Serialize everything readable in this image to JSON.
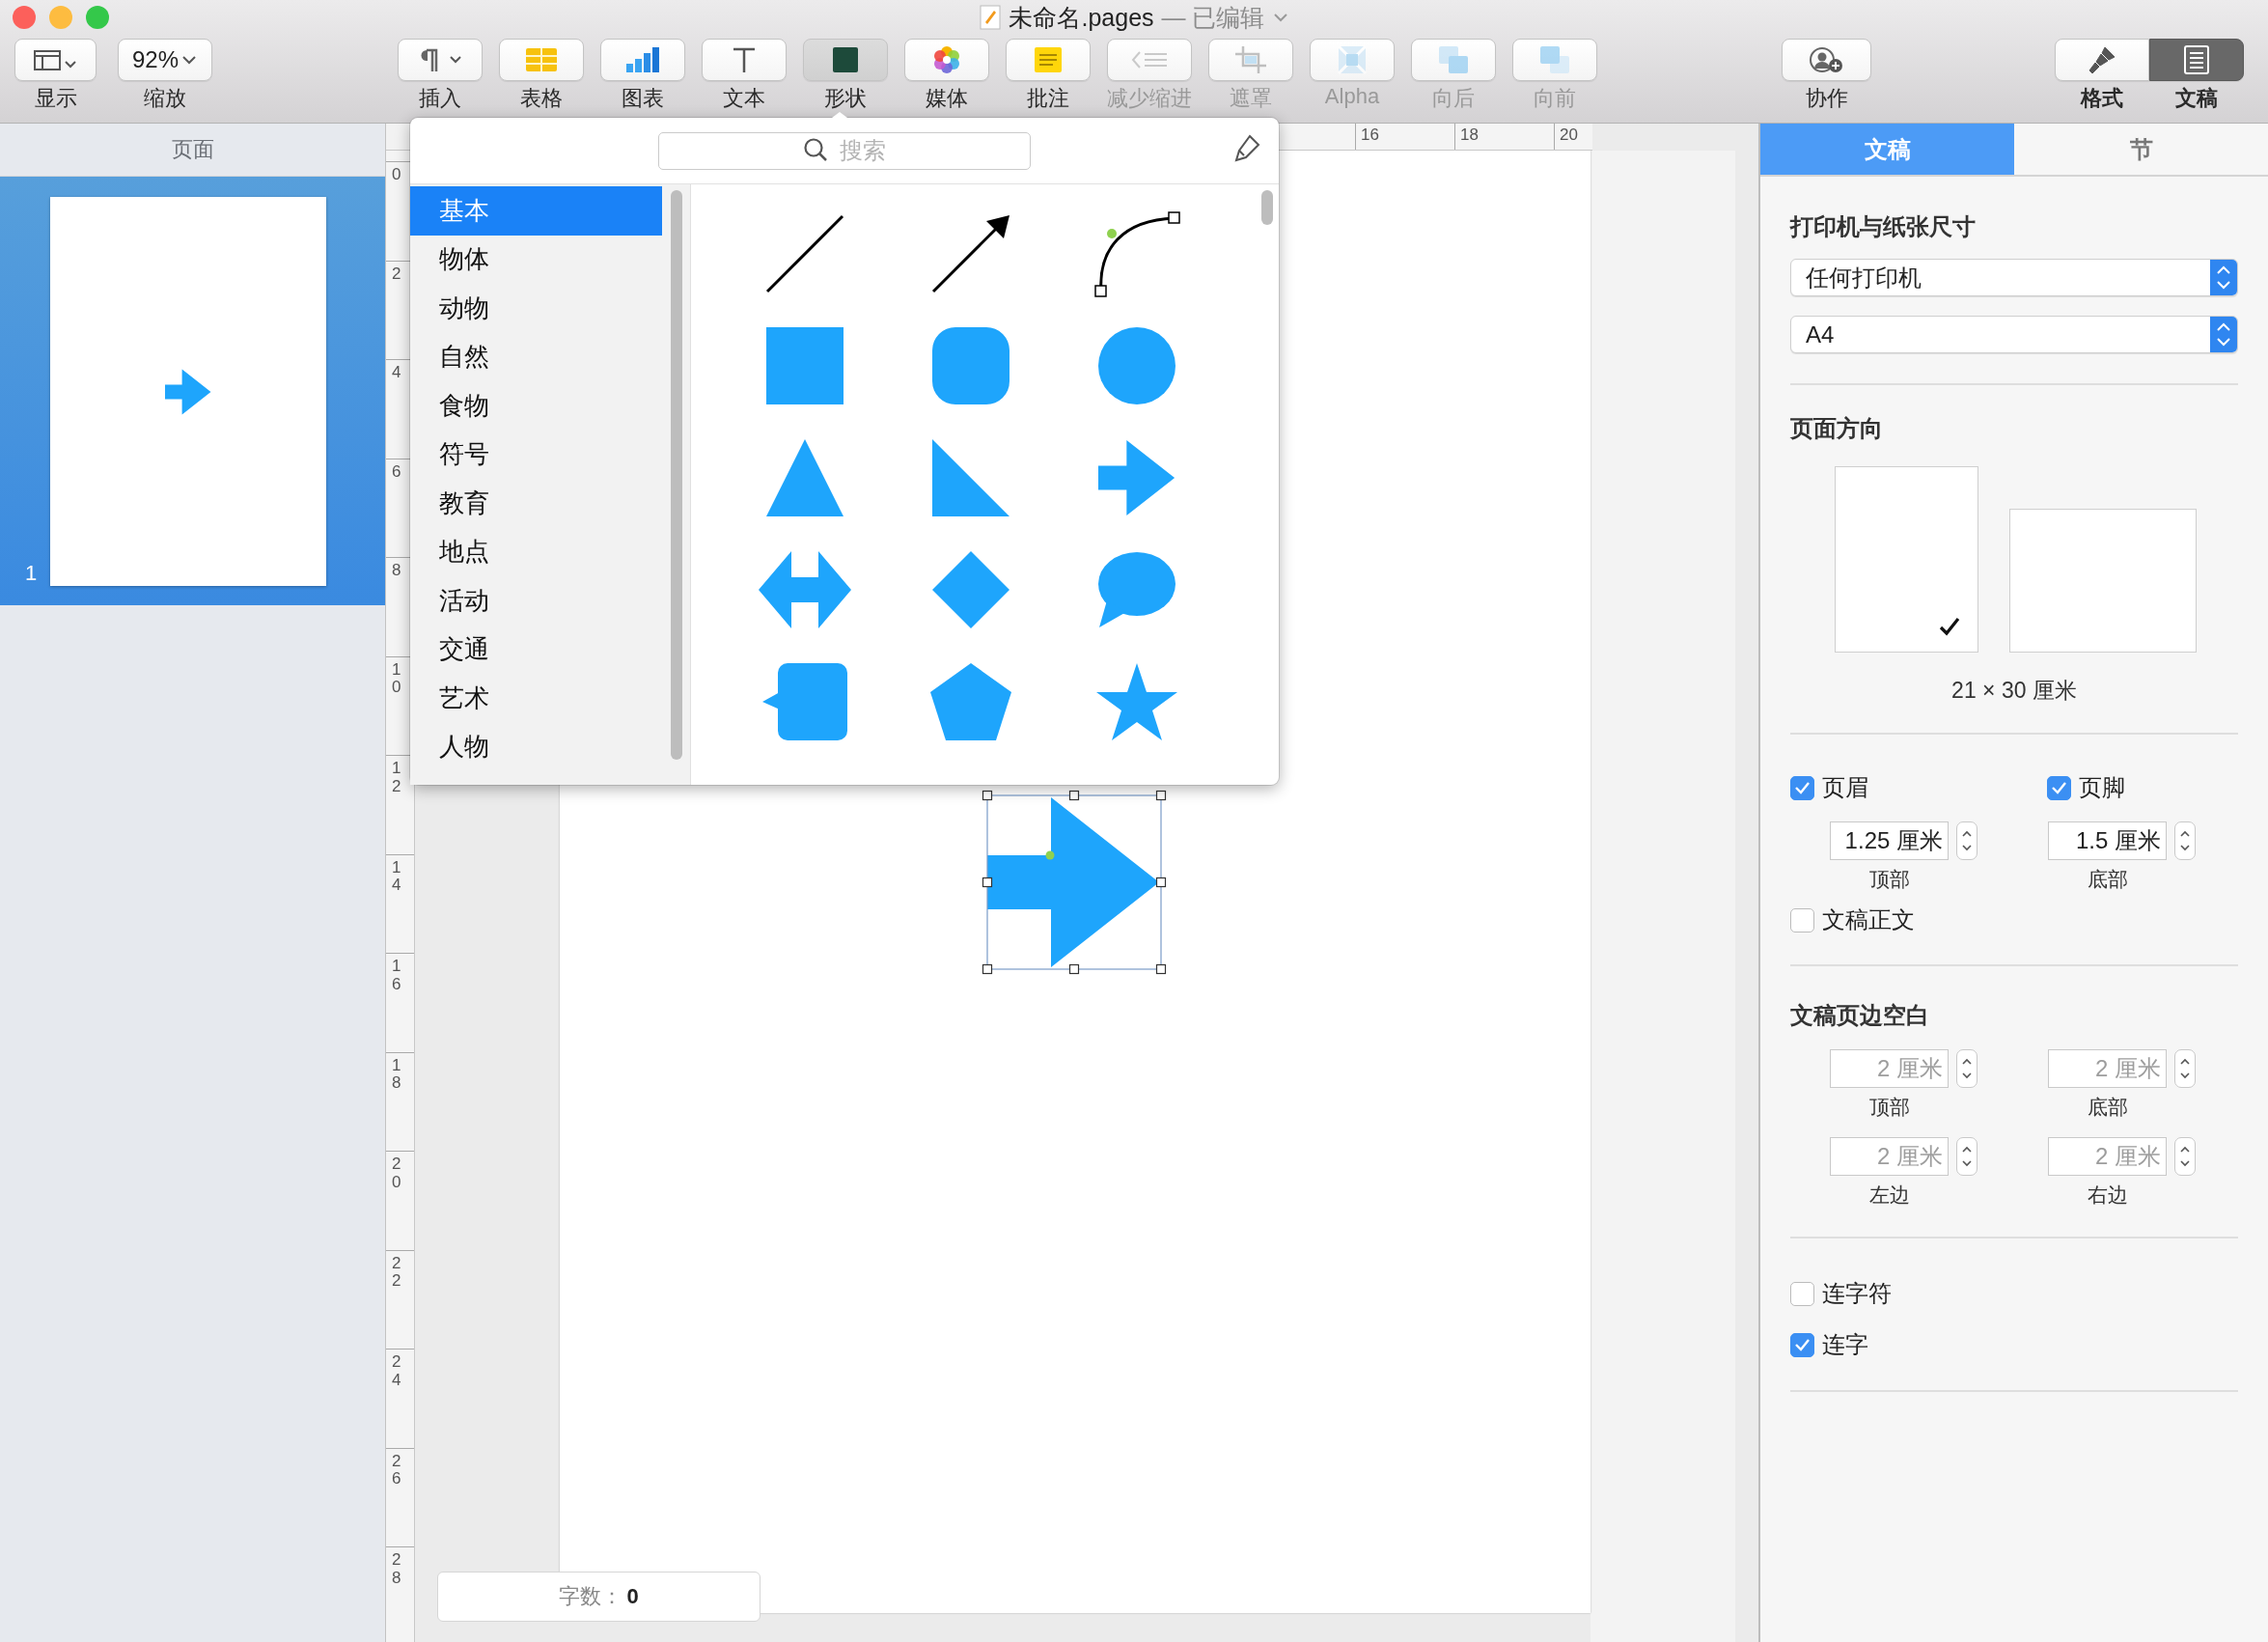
{
  "window": {
    "title": "未命名.pages",
    "status": "— 已编辑"
  },
  "toolbar": {
    "left": [
      {
        "kind": "view",
        "label": "显示",
        "disabled": false,
        "selected": false
      },
      {
        "kind": "zoom",
        "label": "缩放",
        "value": "92%",
        "disabled": false,
        "selected": false
      }
    ],
    "center": [
      {
        "kind": "insert",
        "label": "插入",
        "disabled": false,
        "selected": false
      },
      {
        "kind": "table",
        "label": "表格",
        "disabled": false,
        "selected": false
      },
      {
        "kind": "chart",
        "label": "图表",
        "disabled": false,
        "selected": false
      },
      {
        "kind": "text",
        "label": "文本",
        "disabled": false,
        "selected": false
      },
      {
        "kind": "shape",
        "label": "形状",
        "disabled": false,
        "selected": true
      },
      {
        "kind": "media",
        "label": "媒体",
        "disabled": false,
        "selected": false
      },
      {
        "kind": "comment",
        "label": "批注",
        "disabled": false,
        "selected": false
      },
      {
        "kind": "outdent",
        "label": "减少缩进",
        "disabled": true,
        "selected": false
      },
      {
        "kind": "mask",
        "label": "遮罩",
        "disabled": true,
        "selected": false
      },
      {
        "kind": "alpha",
        "label": "Alpha",
        "disabled": true,
        "selected": false
      },
      {
        "kind": "backward",
        "label": "向后",
        "disabled": true,
        "selected": false
      },
      {
        "kind": "forward",
        "label": "向前",
        "disabled": true,
        "selected": false
      }
    ],
    "collaborate": {
      "label": "协作"
    },
    "switch": [
      {
        "kind": "format",
        "label": "格式",
        "selected": false
      },
      {
        "kind": "document",
        "label": "文稿",
        "selected": true
      }
    ]
  },
  "sidebar": {
    "title": "页面",
    "pages": [
      {
        "number": "1",
        "selected": true
      }
    ]
  },
  "rulers": {
    "horizontal": [
      "16",
      "18",
      "20"
    ],
    "vertical": [
      "0",
      "2",
      "4",
      "6",
      "8",
      "10",
      "12",
      "14",
      "16",
      "18",
      "20",
      "22",
      "24",
      "26",
      "28"
    ]
  },
  "word_count": {
    "label": "字数：",
    "value": "0"
  },
  "shape_popover": {
    "search_placeholder": "搜索",
    "categories": [
      {
        "label": "基本",
        "selected": true
      },
      {
        "label": "物体",
        "selected": false
      },
      {
        "label": "动物",
        "selected": false
      },
      {
        "label": "自然",
        "selected": false
      },
      {
        "label": "食物",
        "selected": false
      },
      {
        "label": "符号",
        "selected": false
      },
      {
        "label": "教育",
        "selected": false
      },
      {
        "label": "地点",
        "selected": false
      },
      {
        "label": "活动",
        "selected": false
      },
      {
        "label": "交通",
        "selected": false
      },
      {
        "label": "艺术",
        "selected": false
      },
      {
        "label": "人物",
        "selected": false
      }
    ]
  },
  "inspector": {
    "tabs": [
      {
        "label": "文稿",
        "selected": true
      },
      {
        "label": "节",
        "selected": false
      }
    ],
    "printer": {
      "title": "打印机与纸张尺寸",
      "printer": "任何打印机",
      "paper": "A4"
    },
    "orientation": {
      "title": "页面方向",
      "options": [
        {
          "kind": "portrait",
          "selected": true
        },
        {
          "kind": "landscape",
          "selected": false
        }
      ],
      "size": "21 × 30 厘米"
    },
    "header_footer": [
      {
        "label": "页眉",
        "checked": true,
        "value": "1.25 厘米",
        "caption": "顶部"
      },
      {
        "label": "页脚",
        "checked": true,
        "value": "1.5 厘米",
        "caption": "底部"
      }
    ],
    "body": {
      "label": "文稿正文",
      "checked": false
    },
    "margins": {
      "title": "文稿页边空白",
      "disabled": true,
      "fields": [
        {
          "value": "2 厘米",
          "caption": "顶部"
        },
        {
          "value": "2 厘米",
          "caption": "底部"
        },
        {
          "value": "2 厘米",
          "caption": "左边"
        },
        {
          "value": "2 厘米",
          "caption": "右边"
        }
      ]
    },
    "options": [
      {
        "label": "连字符",
        "checked": false
      },
      {
        "label": "连字",
        "checked": true
      }
    ]
  }
}
